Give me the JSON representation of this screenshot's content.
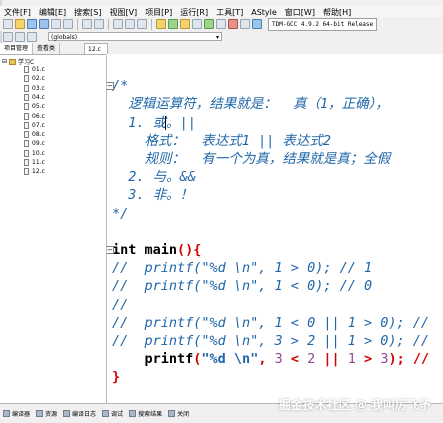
{
  "menu": [
    "文件[F]",
    "编辑[E]",
    "搜索[S]",
    "视图[V]",
    "项目[P]",
    "运行[R]",
    "工具[T]",
    "AStyle",
    "窗口[W]",
    "帮助[H]"
  ],
  "compiler": "TDM-GCC 4.9.2 64-bit Release",
  "scope_combo": "(globals)",
  "panel_tabs": [
    "项目管理",
    "查看类"
  ],
  "editor_tab": "12.c",
  "project": {
    "root": "学习C",
    "files": [
      "01.c",
      "02.c",
      "03.c",
      "04.c",
      "05.c",
      "06.c",
      "07.c",
      "08.c",
      "09.c",
      "10.c",
      "11.c",
      "12.c"
    ]
  },
  "code_lines": [
    {
      "n": "2",
      "parts": [
        {
          "t": "",
          "c": "cm"
        }
      ]
    },
    {
      "n": "3",
      "parts": [
        {
          "t": "/*",
          "c": "cm"
        }
      ]
    },
    {
      "n": "4",
      "parts": [
        {
          "t": "  逻辑运算符，结果就是：  真（1，正确），",
          "c": "cm"
        }
      ]
    },
    {
      "n": "5",
      "parts": [
        {
          "t": "  1. 或。||",
          "c": "cm"
        }
      ]
    },
    {
      "n": "6",
      "parts": [
        {
          "t": "    格式：  表达式1 || 表达式2",
          "c": "cm"
        }
      ]
    },
    {
      "n": "7",
      "parts": [
        {
          "t": "    规则：  有一个为真，结果就是真；全假",
          "c": "cm"
        }
      ]
    },
    {
      "n": "8",
      "parts": [
        {
          "t": "  2. 与。&&",
          "c": "cm"
        }
      ]
    },
    {
      "n": "9",
      "parts": [
        {
          "t": "  3. 非。！",
          "c": "cm"
        }
      ]
    },
    {
      "n": "10",
      "parts": [
        {
          "t": "*/",
          "c": "cm"
        }
      ]
    },
    {
      "n": "11",
      "parts": [
        {
          "t": "",
          "c": "cm"
        }
      ]
    },
    {
      "n": "12",
      "parts": [
        {
          "t": "int main",
          "c": "kw"
        },
        {
          "t": "(){",
          "c": "op"
        }
      ]
    },
    {
      "n": "13",
      "parts": [
        {
          "t": "//  printf(\"%d \\n\", 1 > 0); // 1",
          "c": "cm"
        }
      ]
    },
    {
      "n": "14",
      "parts": [
        {
          "t": "//  printf(\"%d \\n\", 1 < 0); // 0",
          "c": "cm"
        }
      ]
    },
    {
      "n": "15",
      "parts": [
        {
          "t": "//",
          "c": "cm"
        }
      ]
    },
    {
      "n": "16",
      "parts": [
        {
          "t": "//  printf(\"%d \\n\", 1 < 0 || 1 > 0); //",
          "c": "cm"
        }
      ]
    },
    {
      "n": "17",
      "parts": [
        {
          "t": "//  printf(\"%d \\n\", 3 > 2 || 1 > 0); //",
          "c": "cm"
        }
      ]
    },
    {
      "n": "18",
      "parts": [
        {
          "t": "    printf",
          "c": "kw"
        },
        {
          "t": "(",
          "c": "op"
        },
        {
          "t": "\"%d \\n\"",
          "c": "str"
        },
        {
          "t": ", ",
          "c": "op"
        },
        {
          "t": "3",
          "c": "num"
        },
        {
          "t": " < ",
          "c": "op"
        },
        {
          "t": "2",
          "c": "num"
        },
        {
          "t": " || ",
          "c": "op"
        },
        {
          "t": "1",
          "c": "num"
        },
        {
          "t": " > ",
          "c": "op"
        },
        {
          "t": "3",
          "c": "num"
        },
        {
          "t": "); //",
          "c": "op"
        }
      ]
    },
    {
      "n": "19",
      "parts": [
        {
          "t": "}",
          "c": "op"
        }
      ]
    }
  ],
  "bottom_tabs": [
    "编译器",
    "资源",
    "编译日志",
    "调试",
    "搜索结果",
    "关闭"
  ],
  "watermark": "掘金技术社区 @ 我叫厉飞予"
}
